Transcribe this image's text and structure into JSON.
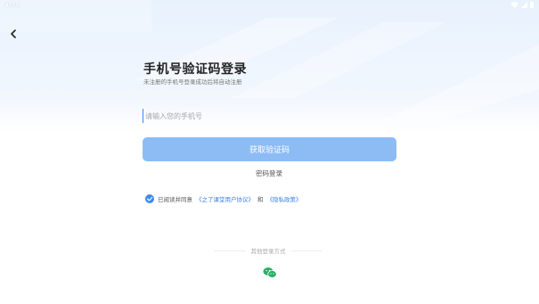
{
  "status_bar": {
    "time": "4:38"
  },
  "header": {
    "title": "手机号验证码登录",
    "subtitle": "未注册的手机号登录成功后将自动注册"
  },
  "form": {
    "phone_placeholder": "请输入您的手机号",
    "get_code_label": "获取验证码",
    "password_login_label": "密码登录"
  },
  "agreement": {
    "prefix": "已阅读并同意",
    "terms_link": "《之了课堂用户协议》",
    "conjunction": "和",
    "privacy_link": "《隐私政策》",
    "checked": true
  },
  "other_login": {
    "label": "其他登录方式",
    "options": [
      "wechat-icon"
    ]
  },
  "colors": {
    "accent": "#3d8bf2",
    "button": "#8dbcf5",
    "wechat": "#2aae67"
  }
}
